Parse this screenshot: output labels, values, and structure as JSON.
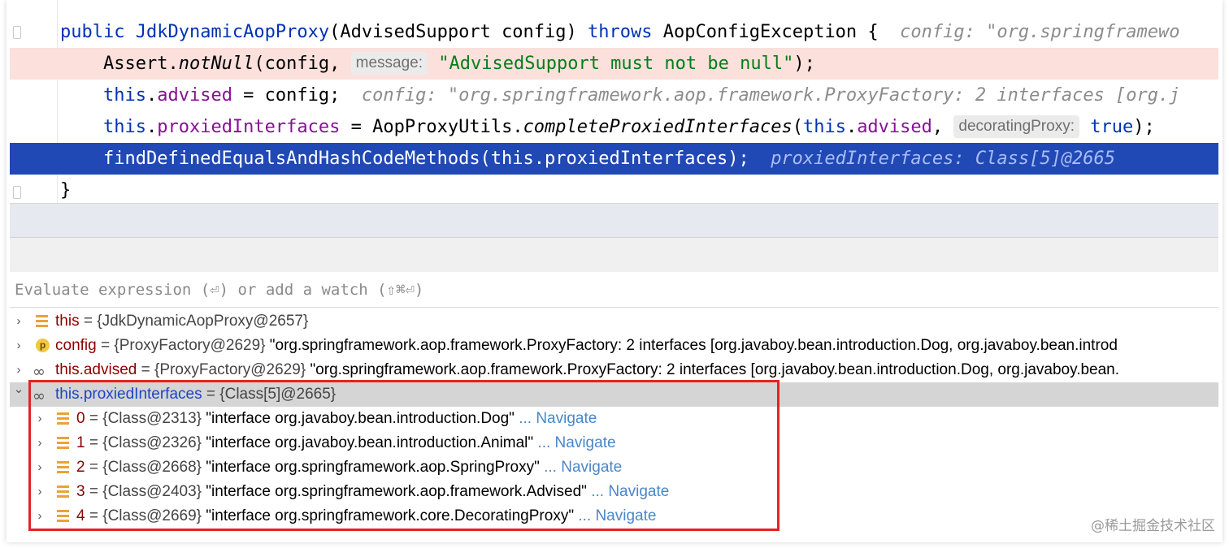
{
  "editor": {
    "lines": [
      {
        "segments": [
          {
            "t": "public ",
            "c": "kw"
          },
          {
            "t": "JdkDynamicAopProxy",
            "c": "kw"
          },
          {
            "t": "(AdvisedSupport config) ",
            "c": ""
          },
          {
            "t": "throws",
            "c": "kw"
          },
          {
            "t": " AopConfigException {  ",
            "c": ""
          },
          {
            "t": "config: \"org.springframewo",
            "c": "hint"
          }
        ]
      },
      {
        "segments": [
          {
            "t": "    Assert.",
            "c": ""
          },
          {
            "t": "notNull",
            "c": "it"
          },
          {
            "t": "(config, ",
            "c": ""
          },
          {
            "t": "message:",
            "c": "inlay"
          },
          {
            "t": " \"AdvisedSupport must not be null\"",
            "c": "str"
          },
          {
            "t": ");",
            "c": ""
          }
        ]
      },
      {
        "segments": [
          {
            "t": "    ",
            "c": ""
          },
          {
            "t": "this",
            "c": "kw"
          },
          {
            "t": ".",
            "c": ""
          },
          {
            "t": "advised",
            "c": "fld"
          },
          {
            "t": " = config;  ",
            "c": ""
          },
          {
            "t": "config: \"org.springframework.aop.framework.ProxyFactory: 2 interfaces [org.j",
            "c": "hint"
          }
        ]
      },
      {
        "segments": [
          {
            "t": "    ",
            "c": ""
          },
          {
            "t": "this",
            "c": "kw"
          },
          {
            "t": ".",
            "c": ""
          },
          {
            "t": "proxiedInterfaces",
            "c": "fld"
          },
          {
            "t": " = AopProxyUtils.",
            "c": ""
          },
          {
            "t": "completeProxiedInterfaces",
            "c": "it"
          },
          {
            "t": "(",
            "c": ""
          },
          {
            "t": "this",
            "c": "kw"
          },
          {
            "t": ".",
            "c": ""
          },
          {
            "t": "advised",
            "c": "fld"
          },
          {
            "t": ", ",
            "c": ""
          },
          {
            "t": "decoratingProxy:",
            "c": "inlay"
          },
          {
            "t": " true",
            "c": "kw"
          },
          {
            "t": ");",
            "c": ""
          }
        ]
      },
      {
        "segments": [
          {
            "t": "    findDefinedEqualsAndHashCodeMethods(this.proxiedInterfaces);  ",
            "c": ""
          },
          {
            "t": "proxiedInterfaces: Class[5]@2665",
            "c": "hint-exec"
          }
        ]
      },
      {
        "segments": [
          {
            "t": "}",
            "c": ""
          }
        ]
      }
    ]
  },
  "evaluate": {
    "placeholder": "Evaluate expression (⏎) or add a watch (⇧⌘⏎)"
  },
  "variables": [
    {
      "icon": "bars",
      "name": "this",
      "name_color": "red",
      "value": " = {JdkDynamicAopProxy@2657}",
      "extra": "",
      "expanded": false,
      "level": 0
    },
    {
      "icon": "p",
      "name": "config",
      "name_color": "red",
      "value": " = {ProxyFactory@2629} ",
      "extra": "\"org.springframework.aop.framework.ProxyFactory: 2 interfaces [org.javaboy.bean.introduction.Dog, org.javaboy.bean.introd",
      "expanded": false,
      "level": 0
    },
    {
      "icon": "glasses",
      "name": "this.advised",
      "name_color": "red",
      "value": " = {ProxyFactory@2629} ",
      "extra": "\"org.springframework.aop.framework.ProxyFactory: 2 interfaces [org.javaboy.bean.introduction.Dog, org.javaboy.bean.",
      "expanded": false,
      "level": 0
    },
    {
      "icon": "glasses",
      "name": "this.proxiedInterfaces",
      "name_color": "blue",
      "value": " = {Class[5]@2665}",
      "extra": "",
      "expanded": true,
      "level": 0
    },
    {
      "icon": "bars",
      "name": "0",
      "name_color": "idx",
      "value": " = {Class@2313} ",
      "extra": "\"interface org.javaboy.bean.introduction.Dog\"",
      "nav": " ... Navigate",
      "expanded": false,
      "level": 1
    },
    {
      "icon": "bars",
      "name": "1",
      "name_color": "idx",
      "value": " = {Class@2326} ",
      "extra": "\"interface org.javaboy.bean.introduction.Animal\"",
      "nav": " ... Navigate",
      "expanded": false,
      "level": 1
    },
    {
      "icon": "bars",
      "name": "2",
      "name_color": "idx",
      "value": " = {Class@2668} ",
      "extra": "\"interface org.springframework.aop.SpringProxy\"",
      "nav": " ... Navigate",
      "expanded": false,
      "level": 1
    },
    {
      "icon": "bars",
      "name": "3",
      "name_color": "idx",
      "value": " = {Class@2403} ",
      "extra": "\"interface org.springframework.aop.framework.Advised\"",
      "nav": " ... Navigate",
      "expanded": false,
      "level": 1
    },
    {
      "icon": "bars",
      "name": "4",
      "name_color": "idx",
      "value": " = {Class@2669} ",
      "extra": "\"interface org.springframework.core.DecoratingProxy\"",
      "nav": " ... Navigate",
      "expanded": false,
      "level": 1
    }
  ],
  "watermark": "@稀土掘金技术社区"
}
